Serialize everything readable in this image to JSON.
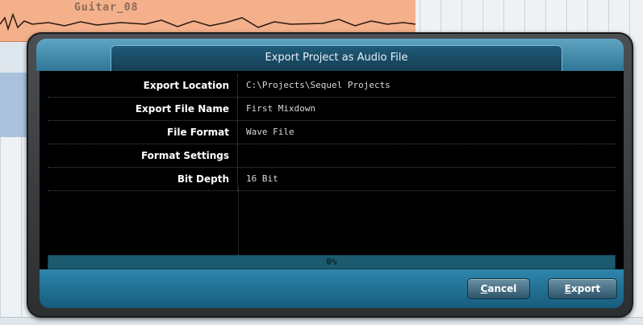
{
  "background": {
    "track_label": "Guitar_08"
  },
  "dialog": {
    "title": "Export Project as Audio File",
    "fields": [
      {
        "label": "Export Location",
        "value": "C:\\Projects\\Sequel Projects"
      },
      {
        "label": "Export File Name",
        "value": "First Mixdown"
      },
      {
        "label": "File Format",
        "value": "Wave File"
      },
      {
        "label": "Format Settings",
        "value": ""
      },
      {
        "label": "Bit Depth",
        "value": "16 Bit"
      }
    ],
    "progress": {
      "value": 0,
      "text": "0%"
    },
    "buttons": {
      "cancel": {
        "accel": "C",
        "rest": "ancel"
      },
      "export": {
        "accel": "E",
        "rest": "xport"
      }
    }
  }
}
